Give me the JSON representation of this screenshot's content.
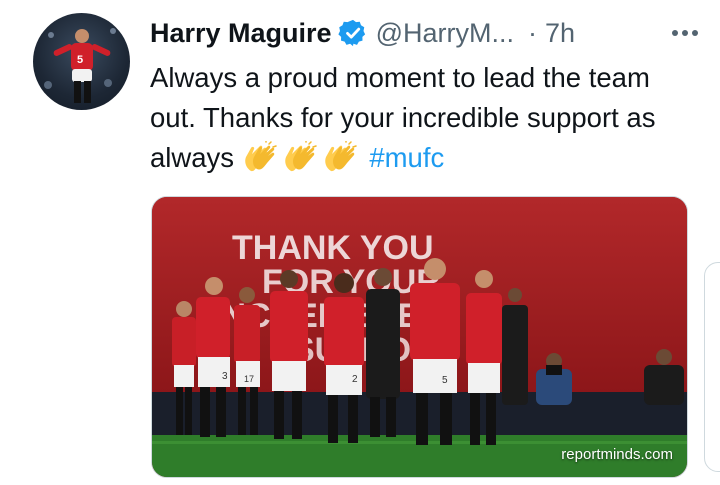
{
  "author": {
    "display_name": "Harry Maguire",
    "handle": "@HarryM...",
    "verified": true,
    "jersey_number": "5"
  },
  "meta": {
    "separator": "·",
    "time_ago": "7h"
  },
  "tweet": {
    "text_before_emoji": "Always a proud moment to lead the team out. Thanks for your incredible support as always",
    "emojis": [
      "clapping-hands",
      "clapping-hands",
      "clapping-hands"
    ],
    "hashtag": "#mufc"
  },
  "media": {
    "banner_text": "THANK YOU FOR YOUR INCREDIBLE SUPPORT",
    "watermark": "reportminds.com",
    "player_numbers": [
      "3",
      "17",
      "2",
      "5"
    ]
  },
  "colors": {
    "verified_blue": "#1d9bf0",
    "hashtag_blue": "#1d9bf0",
    "secondary_text": "#536471",
    "kit_red": "#d0202a",
    "pitch_green": "#2f7d2a"
  }
}
